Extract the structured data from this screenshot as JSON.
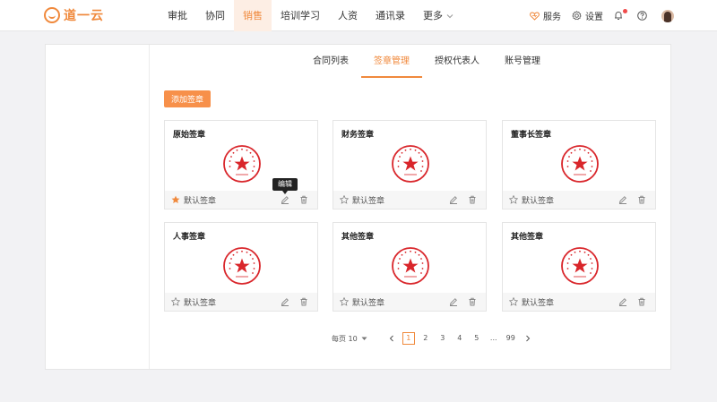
{
  "header": {
    "logo_text": "道一云",
    "nav": [
      {
        "label": "审批"
      },
      {
        "label": "协同"
      },
      {
        "label": "销售"
      },
      {
        "label": "培训学习"
      },
      {
        "label": "人资"
      },
      {
        "label": "通讯录"
      },
      {
        "label": "更多"
      }
    ],
    "active_nav": "销售",
    "service_label": "服务",
    "settings_label": "设置",
    "has_notification": true
  },
  "tabs": [
    {
      "label": "合同列表"
    },
    {
      "label": "签章管理"
    },
    {
      "label": "授权代表人"
    },
    {
      "label": "账号管理"
    }
  ],
  "active_tab": "签章管理",
  "add_button_label": "添加签章",
  "cards": [
    {
      "title": "原始签章",
      "default_label": "默认签章",
      "is_default": true
    },
    {
      "title": "财务签章",
      "default_label": "默认签章",
      "is_default": false
    },
    {
      "title": "董事长签章",
      "default_label": "默认签章",
      "is_default": false
    },
    {
      "title": "人事签章",
      "default_label": "默认签章",
      "is_default": false
    },
    {
      "title": "其他签章",
      "default_label": "默认签章",
      "is_default": false
    },
    {
      "title": "其他签章",
      "default_label": "默认签章",
      "is_default": false
    }
  ],
  "tooltip_label": "编辑",
  "pagination": {
    "per_page_label": "每页 10",
    "pages": [
      "1",
      "2",
      "3",
      "4",
      "5",
      "...",
      "99"
    ],
    "current": "1"
  },
  "colors": {
    "accent": "#f0893c",
    "seal_red": "#d9262b"
  }
}
